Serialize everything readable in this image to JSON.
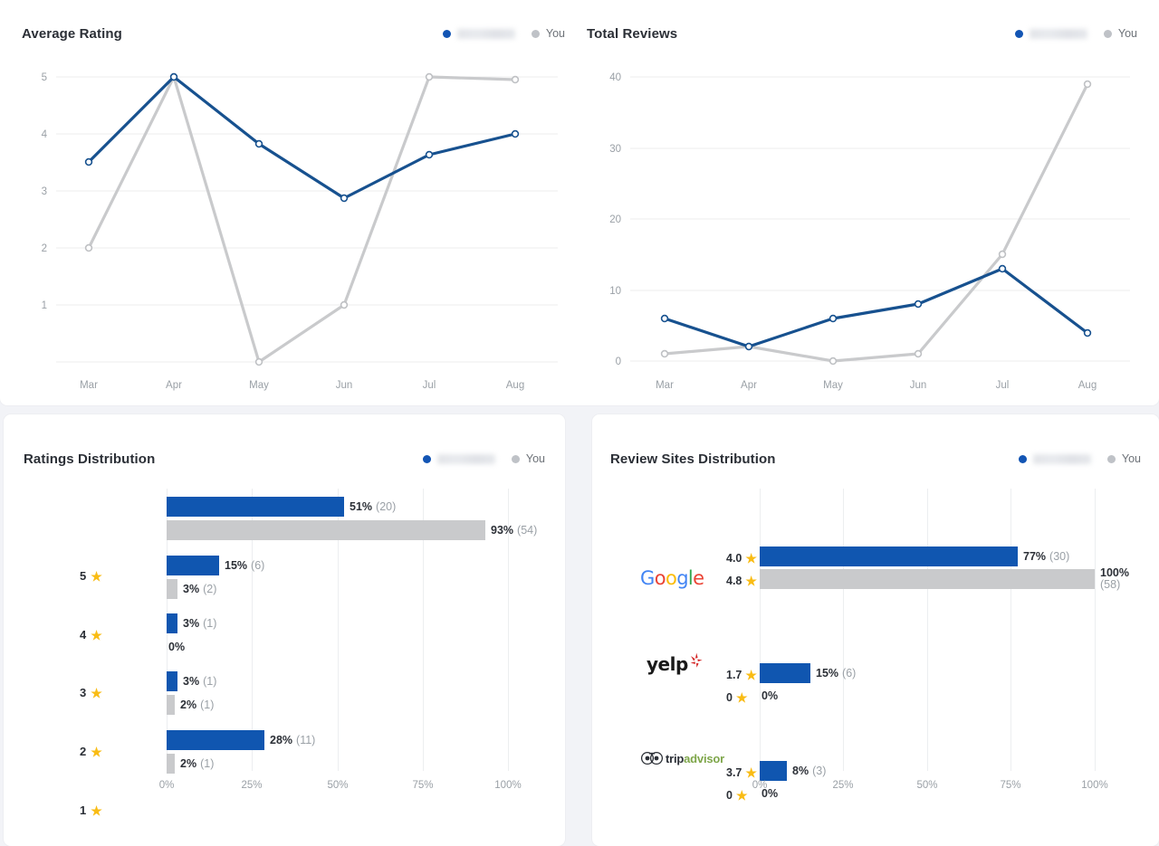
{
  "panels": {
    "average_rating": {
      "title": "Average Rating"
    },
    "total_reviews": {
      "title": "Total Reviews"
    },
    "ratings_distribution": {
      "title": "Ratings Distribution"
    },
    "review_sites_distribution": {
      "title": "Review Sites Distribution"
    }
  },
  "legend": {
    "competitor_label": "",
    "you_label": "You",
    "competitor_color": "#1355b4",
    "you_color": "#bfc2c7"
  },
  "colors": {
    "line_blue": "#17518f",
    "line_gray": "#c9cacc",
    "bar_blue": "#1056b0",
    "bar_gray": "#c9cacc",
    "star_gold": "#f9bc15",
    "card_bg": "#ffffff",
    "page_bg": "#f2f3f7",
    "gridline": "#ececee",
    "axis_text": "#9aa0a6",
    "title_text": "#2b2f36"
  },
  "chart_data": [
    {
      "type": "line",
      "title": "Average Rating",
      "xlabel": "",
      "ylabel": "",
      "categories": [
        "Mar",
        "Apr",
        "May",
        "Jun",
        "Jul",
        "Aug"
      ],
      "yticks": [
        1,
        2,
        3,
        4,
        5
      ],
      "ylim": [
        0,
        5
      ],
      "grid": true,
      "legend_position": "top-right",
      "series": [
        {
          "name": "",
          "color": "#17518f",
          "values": [
            3.5,
            5.0,
            3.83,
            2.88,
            3.63,
            4.0
          ]
        },
        {
          "name": "You",
          "color": "#c9cacc",
          "values": [
            2.0,
            5.0,
            0.0,
            1.0,
            5.0,
            4.95
          ]
        }
      ]
    },
    {
      "type": "line",
      "title": "Total Reviews",
      "xlabel": "",
      "ylabel": "",
      "categories": [
        "Mar",
        "Apr",
        "May",
        "Jun",
        "Jul",
        "Aug"
      ],
      "yticks": [
        0,
        10,
        20,
        30,
        40
      ],
      "ylim": [
        0,
        40
      ],
      "grid": true,
      "legend_position": "top-right",
      "series": [
        {
          "name": "",
          "color": "#17518f",
          "values": [
            6,
            2,
            6,
            8,
            13,
            4
          ]
        },
        {
          "name": "You",
          "color": "#c9cacc",
          "values": [
            1,
            2,
            0,
            1,
            15,
            39
          ]
        }
      ]
    },
    {
      "type": "bar",
      "orientation": "horizontal",
      "title": "Ratings Distribution",
      "xlabel": "",
      "ylabel": "",
      "xticks": [
        "0%",
        "25%",
        "50%",
        "75%",
        "100%"
      ],
      "xlim": [
        0,
        100
      ],
      "categories": [
        "5",
        "4",
        "3",
        "2",
        "1"
      ],
      "category_suffix": "star",
      "rows": [
        {
          "label": "5",
          "competitor": {
            "pct": 51,
            "pct_label": "51%",
            "count_label": "(20)"
          },
          "you": {
            "pct": 93,
            "pct_label": "93%",
            "count_label": "(54)"
          }
        },
        {
          "label": "4",
          "competitor": {
            "pct": 15,
            "pct_label": "15%",
            "count_label": "(6)"
          },
          "you": {
            "pct": 3,
            "pct_label": "3%",
            "count_label": "(2)"
          }
        },
        {
          "label": "3",
          "competitor": {
            "pct": 3,
            "pct_label": "3%",
            "count_label": "(1)"
          },
          "you": {
            "pct": 0,
            "pct_label": "0%",
            "count_label": ""
          }
        },
        {
          "label": "2",
          "competitor": {
            "pct": 3,
            "pct_label": "3%",
            "count_label": "(1)"
          },
          "you": {
            "pct": 2,
            "pct_label": "2%",
            "count_label": "(1)"
          }
        },
        {
          "label": "1",
          "competitor": {
            "pct": 28,
            "pct_label": "28%",
            "count_label": "(11)"
          },
          "you": {
            "pct": 2,
            "pct_label": "2%",
            "count_label": "(1)"
          }
        }
      ]
    },
    {
      "type": "bar",
      "orientation": "horizontal",
      "title": "Review Sites Distribution",
      "xlabel": "",
      "ylabel": "",
      "xticks": [
        "0%",
        "25%",
        "50%",
        "75%",
        "100%"
      ],
      "xlim": [
        0,
        100
      ],
      "categories": [
        "Google",
        "Yelp",
        "TripAdvisor"
      ],
      "rows": [
        {
          "site": "Google",
          "competitor": {
            "rating": "4.0",
            "pct": 77,
            "pct_label": "77%",
            "count_label": "(30)"
          },
          "you": {
            "rating": "4.8",
            "pct": 100,
            "pct_label": "100%",
            "count_label": "(58)"
          }
        },
        {
          "site": "Yelp",
          "competitor": {
            "rating": "1.7",
            "pct": 15,
            "pct_label": "15%",
            "count_label": "(6)"
          },
          "you": {
            "rating": "0",
            "pct": 0,
            "pct_label": "0%",
            "count_label": ""
          }
        },
        {
          "site": "TripAdvisor",
          "competitor": {
            "rating": "3.7",
            "pct": 8,
            "pct_label": "8%",
            "count_label": "(3)"
          },
          "you": {
            "rating": "0",
            "pct": 0,
            "pct_label": "0%",
            "count_label": ""
          }
        }
      ]
    }
  ],
  "site_logos": {
    "google": {
      "letters": [
        "G",
        "o",
        "o",
        "g",
        "l",
        "e"
      ]
    },
    "yelp": {
      "text": "yelp"
    },
    "tripadvisor": {
      "text1": "trip",
      "text2": "advisor"
    }
  }
}
